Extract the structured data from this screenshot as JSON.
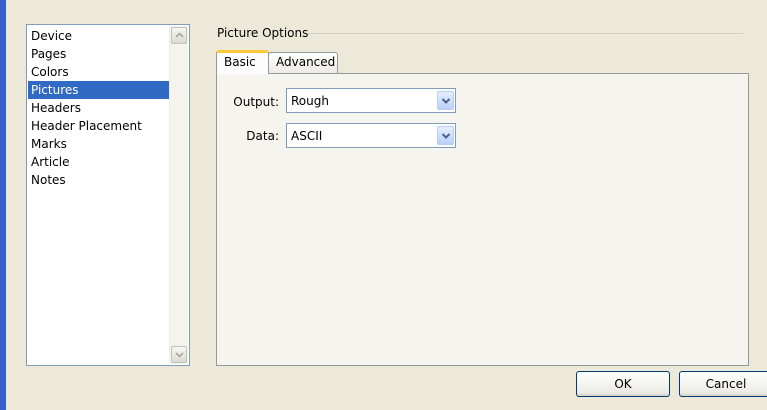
{
  "sidebar": {
    "items": [
      {
        "label": "Device",
        "selected": false
      },
      {
        "label": "Pages",
        "selected": false
      },
      {
        "label": "Colors",
        "selected": false
      },
      {
        "label": "Pictures",
        "selected": true
      },
      {
        "label": "Headers",
        "selected": false
      },
      {
        "label": "Header Placement",
        "selected": false
      },
      {
        "label": "Marks",
        "selected": false
      },
      {
        "label": "Article",
        "selected": false
      },
      {
        "label": "Notes",
        "selected": false
      }
    ]
  },
  "group": {
    "title": "Picture Options"
  },
  "tabs": [
    {
      "label": "Basic",
      "active": true
    },
    {
      "label": "Advanced",
      "active": false
    }
  ],
  "form": {
    "output": {
      "label": "Output:",
      "value": "Rough"
    },
    "data": {
      "label": "Data:",
      "value": "ASCII"
    }
  },
  "buttons": {
    "ok": "OK",
    "cancel": "Cancel"
  },
  "colors": {
    "selection": "#316ac5",
    "window": "#ece9d8",
    "tab_highlight": "#ffc83c"
  },
  "icons": {
    "scroll_up": "chevron-up-icon",
    "scroll_down": "chevron-down-icon",
    "dropdown": "chevron-down-icon"
  }
}
